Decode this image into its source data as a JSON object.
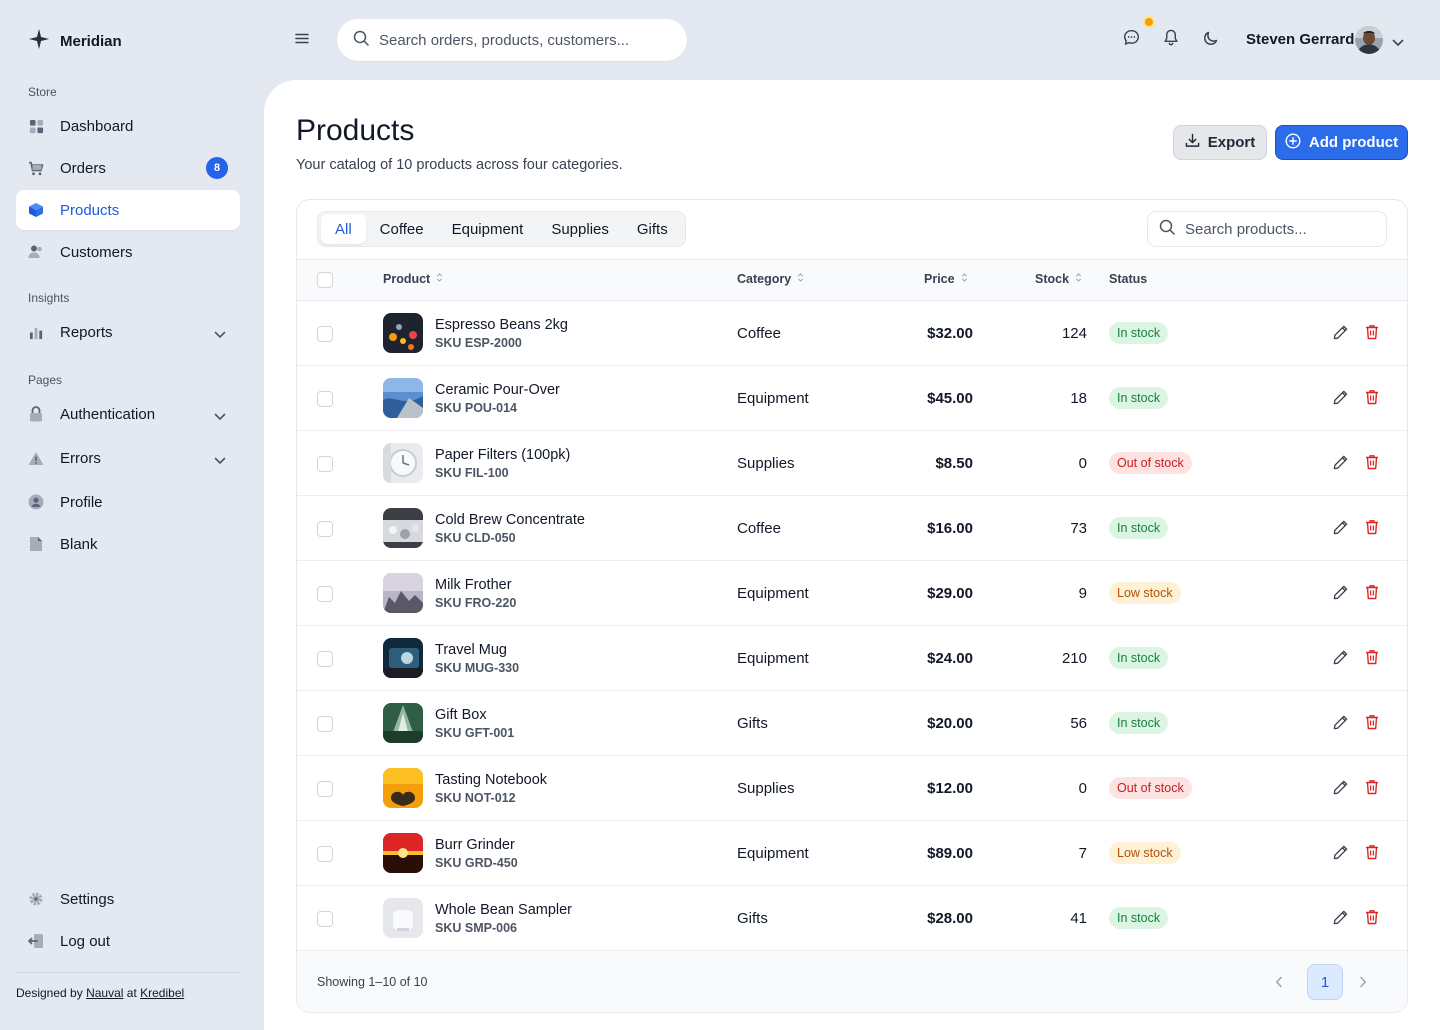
{
  "brand": {
    "name": "Meridian"
  },
  "sidebar": {
    "sections": [
      {
        "label": "Store"
      },
      {
        "label": "Insights"
      },
      {
        "label": "Pages"
      }
    ],
    "items": [
      {
        "label": "Dashboard",
        "icon": "grid-icon"
      },
      {
        "label": "Orders",
        "icon": "cart-icon",
        "badge": "8"
      },
      {
        "label": "Products",
        "icon": "box-icon",
        "active": true
      },
      {
        "label": "Customers",
        "icon": "users-icon"
      },
      {
        "label": "Reports",
        "icon": "bar-chart-icon",
        "expandable": true
      },
      {
        "label": "Authentication",
        "icon": "lock-icon",
        "expandable": true
      },
      {
        "label": "Errors",
        "icon": "warning-icon",
        "expandable": true
      },
      {
        "label": "Profile",
        "icon": "user-circle-icon"
      },
      {
        "label": "Blank",
        "icon": "file-icon"
      }
    ],
    "bottom_items": [
      {
        "label": "Settings",
        "icon": "gear-icon"
      },
      {
        "label": "Log out",
        "icon": "logout-icon"
      }
    ],
    "footer": {
      "prefix": "Designed by",
      "author": "Nauval",
      "middle": "at",
      "company": "Kredibel"
    }
  },
  "topbar": {
    "search_placeholder": "Search orders, products, customers...",
    "user_name": "Steven Gerrard"
  },
  "page": {
    "title": "Products",
    "subtitle": "Your catalog of 10 products across four categories.",
    "export_label": "Export",
    "add_label": "Add product"
  },
  "tabs": [
    {
      "label": "All",
      "active": true
    },
    {
      "label": "Coffee"
    },
    {
      "label": "Equipment"
    },
    {
      "label": "Supplies"
    },
    {
      "label": "Gifts"
    }
  ],
  "table": {
    "search_placeholder": "Search products...",
    "columns": {
      "product": "Product",
      "category": "Category",
      "price": "Price",
      "stock": "Stock",
      "status": "Status"
    },
    "rows": [
      {
        "name": "Espresso Beans 2kg",
        "sku": "SKU ESP-2000",
        "category": "Coffee",
        "price": "$32.00",
        "stock": "124",
        "status": "In stock",
        "status_type": "in"
      },
      {
        "name": "Ceramic Pour-Over",
        "sku": "SKU POU-014",
        "category": "Equipment",
        "price": "$45.00",
        "stock": "18",
        "status": "In stock",
        "status_type": "in"
      },
      {
        "name": "Paper Filters (100pk)",
        "sku": "SKU FIL-100",
        "category": "Supplies",
        "price": "$8.50",
        "stock": "0",
        "status": "Out of stock",
        "status_type": "out"
      },
      {
        "name": "Cold Brew Concentrate",
        "sku": "SKU CLD-050",
        "category": "Coffee",
        "price": "$16.00",
        "stock": "73",
        "status": "In stock",
        "status_type": "in"
      },
      {
        "name": "Milk Frother",
        "sku": "SKU FRO-220",
        "category": "Equipment",
        "price": "$29.00",
        "stock": "9",
        "status": "Low stock",
        "status_type": "low"
      },
      {
        "name": "Travel Mug",
        "sku": "SKU MUG-330",
        "category": "Equipment",
        "price": "$24.00",
        "stock": "210",
        "status": "In stock",
        "status_type": "in"
      },
      {
        "name": "Gift Box",
        "sku": "SKU GFT-001",
        "category": "Gifts",
        "price": "$20.00",
        "stock": "56",
        "status": "In stock",
        "status_type": "in"
      },
      {
        "name": "Tasting Notebook",
        "sku": "SKU NOT-012",
        "category": "Supplies",
        "price": "$12.00",
        "stock": "0",
        "status": "Out of stock",
        "status_type": "out"
      },
      {
        "name": "Burr Grinder",
        "sku": "SKU GRD-450",
        "category": "Equipment",
        "price": "$89.00",
        "stock": "7",
        "status": "Low stock",
        "status_type": "low"
      },
      {
        "name": "Whole Bean Sampler",
        "sku": "SKU SMP-006",
        "category": "Gifts",
        "price": "$28.00",
        "stock": "41",
        "status": "In stock",
        "status_type": "in"
      }
    ]
  },
  "pagination": {
    "summary": "Showing 1–10 of 10",
    "current": "1"
  }
}
